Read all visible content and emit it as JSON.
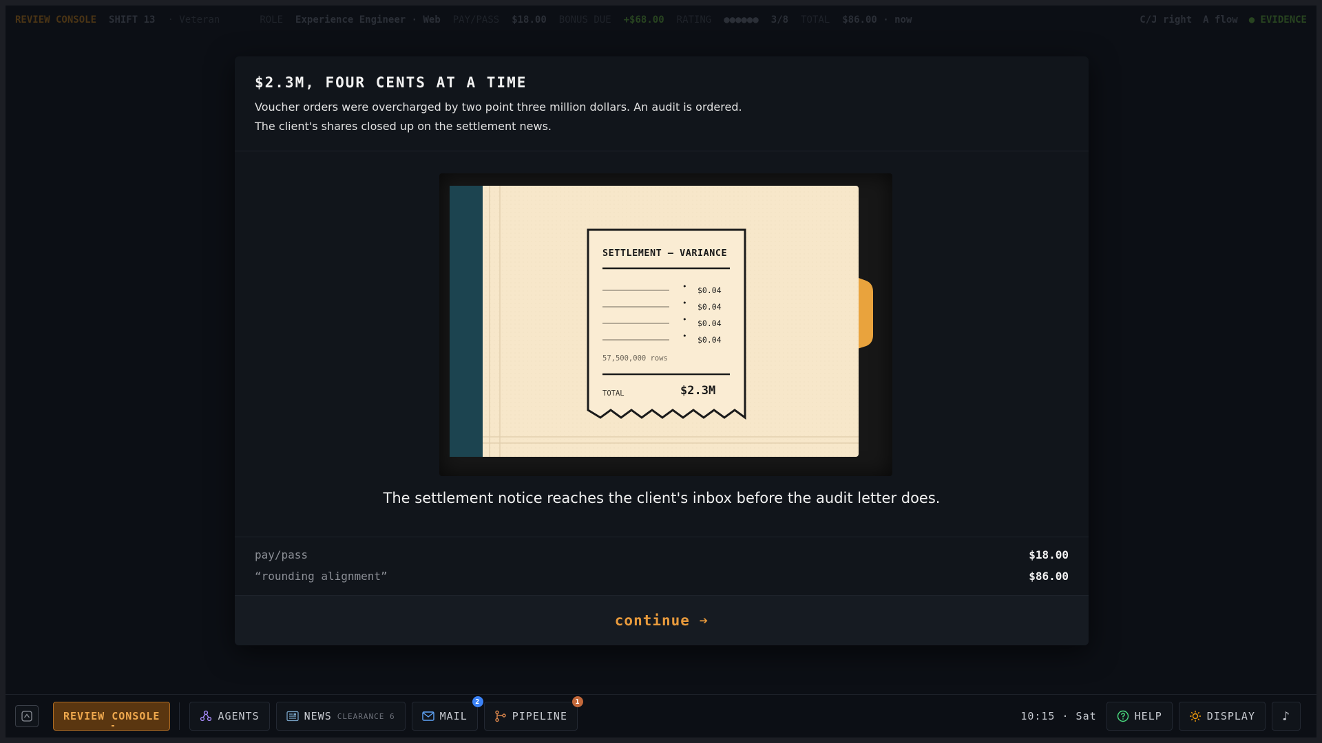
{
  "topbar": {
    "console": "REVIEW CONSOLE",
    "shift": "SHIFT 13",
    "shift_sub": "· Veteran",
    "role_prefix": "ROLE",
    "role": "Experience Engineer · Web",
    "pay_label": "PAY/PASS",
    "pay": "$18.00",
    "bonus_label": "BONUS DUE",
    "bonus": "+$68.00",
    "rating_label": "RATING",
    "rating": "●●●●●●",
    "count": "3/8",
    "total_label": "TOTAL",
    "total": "$86.00 · now",
    "right_a": "C/J right",
    "right_b": "A flow",
    "evidence": "● EVIDENCE"
  },
  "card": {
    "title": "$2.3M, FOUR CENTS AT A TIME",
    "subtitle_1": "Voucher orders were overcharged by two point three million dollars. An audit is ordered.",
    "subtitle_2": "The client's shares closed up on the settlement news.",
    "caption": "The settlement notice reaches the client's inbox before the audit letter does.",
    "ledger": [
      {
        "label": "pay/pass",
        "amount": "$18.00"
      },
      {
        "label": "“rounding alignment”",
        "amount": "$86.00"
      }
    ],
    "continue_label": "continue ➔"
  },
  "receipt": {
    "title": "SETTLEMENT — VARIANCE",
    "lines": [
      "$0.04",
      "$0.04",
      "$0.04",
      "$0.04"
    ],
    "bullet": "•",
    "rows": "57,500,000 rows",
    "total_label": "TOTAL",
    "total": "$2.3M"
  },
  "taskbar": {
    "review_console": "REVIEW CONSOLE",
    "agents": "AGENTS",
    "news": "NEWS",
    "news_sub": "CLEARANCE 6",
    "mail": "MAIL",
    "mail_badge": "2",
    "pipeline": "PIPELINE",
    "pipeline_badge": "1",
    "clock": "10:15 · Sat",
    "help": "HELP",
    "display": "DISPLAY",
    "music_icon": "♪"
  },
  "colors": {
    "accent": "#e89a3c",
    "mail_badge": "#3b82f6",
    "pipeline_badge": "#c2683a",
    "help_icon": "#4ade80",
    "display_icon": "#f59e0b"
  }
}
